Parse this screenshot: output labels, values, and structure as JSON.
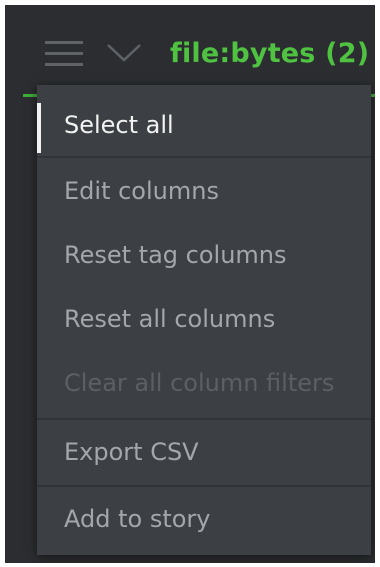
{
  "header": {
    "title": "file:bytes (2)"
  },
  "menu": {
    "items": [
      {
        "label": "Select all",
        "state": "active"
      },
      {
        "label": "Edit columns",
        "state": "enabled"
      },
      {
        "label": "Reset tag columns",
        "state": "enabled"
      },
      {
        "label": "Reset all columns",
        "state": "enabled"
      },
      {
        "label": "Clear all column filters",
        "state": "disabled"
      },
      {
        "label": "Export CSV",
        "state": "enabled"
      },
      {
        "label": "Add to story",
        "state": "enabled"
      }
    ]
  },
  "colors": {
    "panel_background": "#2b2d30",
    "menu_background": "#3c3f43",
    "accent_green": "#4fc341",
    "active_text": "#f2f2f2",
    "enabled_text": "#a3a7ab",
    "disabled_text": "#5c5f63"
  },
  "icons": {
    "menu_toggle": "hamburger-icon",
    "dropdown": "chevron-down-icon"
  }
}
